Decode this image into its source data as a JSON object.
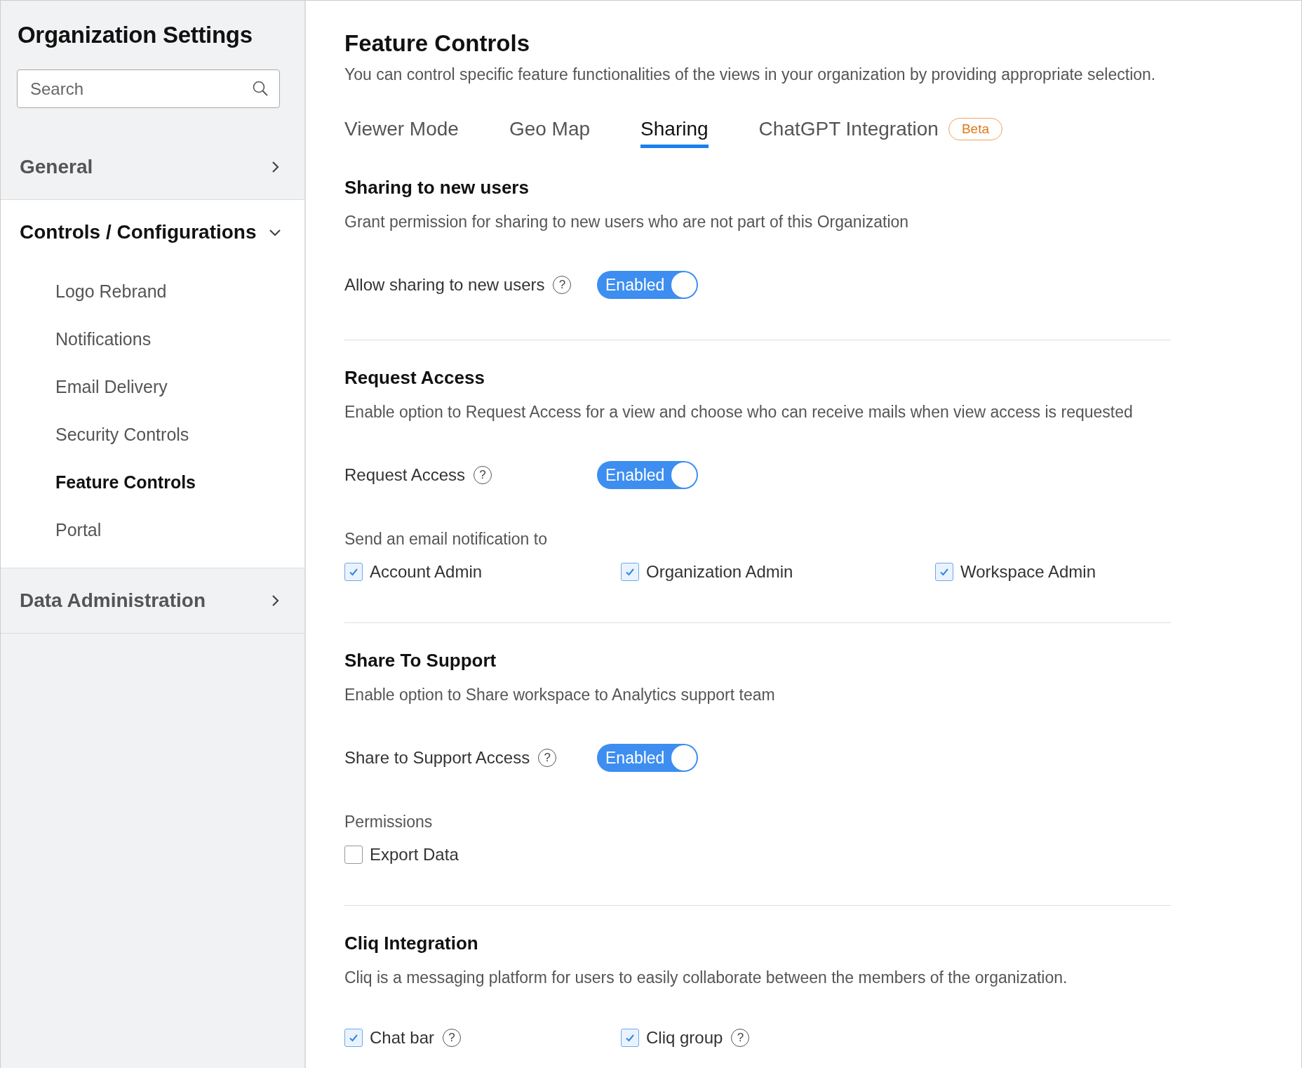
{
  "sidebar": {
    "title": "Organization Settings",
    "search": {
      "placeholder": "Search"
    },
    "sections": [
      {
        "label": "General",
        "expanded": false
      },
      {
        "label": "Controls / Configurations",
        "expanded": true,
        "children": [
          {
            "label": "Logo Rebrand",
            "selected": false
          },
          {
            "label": "Notifications",
            "selected": false
          },
          {
            "label": "Email Delivery",
            "selected": false
          },
          {
            "label": "Security Controls",
            "selected": false
          },
          {
            "label": "Feature Controls",
            "selected": true
          },
          {
            "label": "Portal",
            "selected": false
          }
        ]
      },
      {
        "label": "Data Administration",
        "expanded": false
      }
    ]
  },
  "main": {
    "title": "Feature Controls",
    "description": "You can control specific feature functionalities of the views in your organization by providing appropriate selection.",
    "tabs": [
      {
        "label": "Viewer Mode",
        "selected": false
      },
      {
        "label": "Geo Map",
        "selected": false
      },
      {
        "label": "Sharing",
        "selected": true
      },
      {
        "label": "ChatGPT Integration",
        "selected": false,
        "badge": "Beta"
      }
    ],
    "sections": [
      {
        "title": "Sharing to new users",
        "description": "Grant permission for sharing to new users who are not part of this Organization",
        "rows": [
          {
            "kind": "toggle",
            "label": "Allow sharing to new users",
            "help": "?",
            "on": true,
            "state_text": "Enabled"
          }
        ]
      },
      {
        "title": "Request Access",
        "description": "Enable option to Request Access for a view and choose who can receive mails when view access is requested",
        "rows": [
          {
            "kind": "toggle",
            "label": "Request Access",
            "help": "?",
            "on": true,
            "state_text": "Enabled"
          },
          {
            "kind": "checks",
            "caption": "Send an email notification to",
            "items": [
              {
                "label": "Account Admin",
                "checked": true
              },
              {
                "label": "Organization Admin",
                "checked": true
              },
              {
                "label": "Workspace Admin",
                "checked": true
              }
            ]
          }
        ]
      },
      {
        "title": "Share To Support",
        "description": "Enable option to Share workspace to Analytics support team",
        "rows": [
          {
            "kind": "toggle",
            "label": "Share to Support Access",
            "help": "?",
            "on": true,
            "state_text": "Enabled"
          },
          {
            "kind": "checks",
            "caption": "Permissions",
            "items": [
              {
                "label": "Export Data",
                "checked": false
              }
            ]
          }
        ]
      },
      {
        "title": "Cliq Integration",
        "description": "Cliq is a messaging platform for users to easily collaborate between the members of the organization.",
        "rows": [
          {
            "kind": "checks",
            "items": [
              {
                "label": "Chat bar",
                "checked": true,
                "help": "?"
              },
              {
                "label": "Cliq group",
                "checked": true,
                "help": "?"
              }
            ]
          }
        ]
      }
    ]
  }
}
